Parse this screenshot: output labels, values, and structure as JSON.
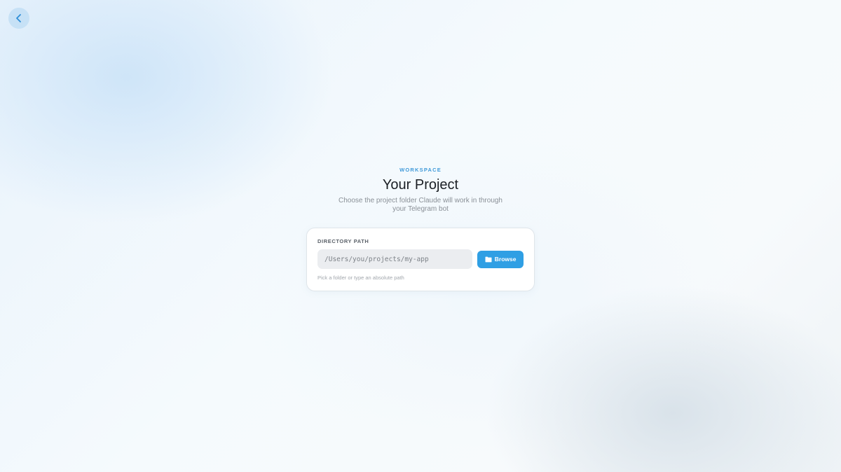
{
  "header": {
    "back_icon": "chevron-left-icon"
  },
  "hero": {
    "eyebrow": "WORKSPACE",
    "title": "Your Project",
    "subtitle": "Choose the project folder Claude will work in through your Telegram bot"
  },
  "directory": {
    "label": "DIRECTORY PATH",
    "placeholder": "/Users/you/projects/my-app",
    "value": "",
    "browse_label": "Browse",
    "browse_icon": "folder-icon",
    "hint": "Pick a folder or type an absolute path"
  },
  "colors": {
    "accent": "#2f9fe4",
    "eyebrow": "#3f9ad9",
    "title": "#1b1f24"
  }
}
